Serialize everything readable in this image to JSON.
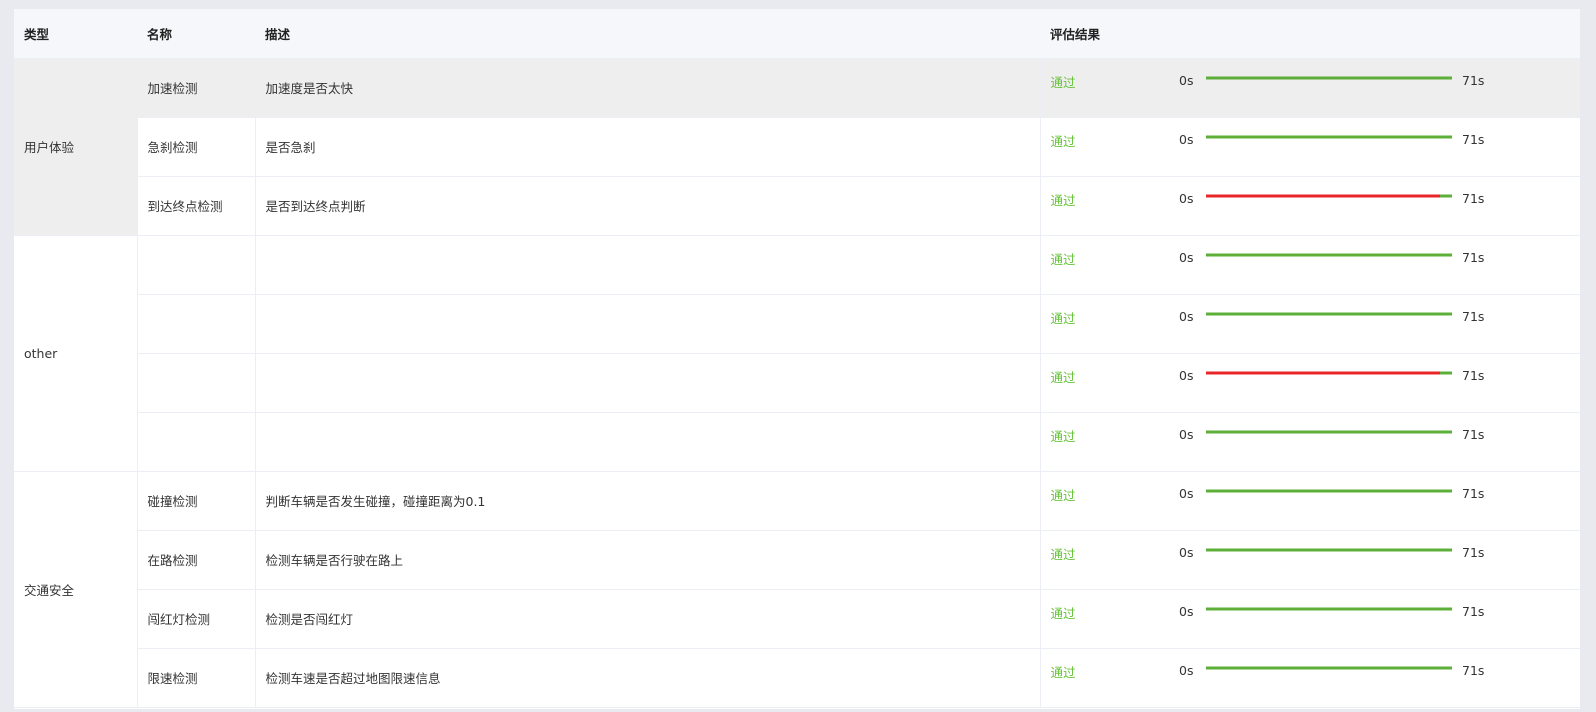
{
  "table": {
    "headers": {
      "type": "类型",
      "name": "名称",
      "desc": "描述",
      "result": "评估结果"
    },
    "groups": [
      {
        "label": "用户体验"
      },
      {
        "label": "other"
      },
      {
        "label": "交通安全"
      }
    ],
    "rows": [
      {
        "name": "加速检测",
        "desc": "加速度是否太快",
        "result": "通过",
        "start": "0s",
        "end": "71s",
        "fail_fraction": 0,
        "highlight": true
      },
      {
        "name": "急刹检测",
        "desc": "是否急刹",
        "result": "通过",
        "start": "0s",
        "end": "71s",
        "fail_fraction": 0
      },
      {
        "name": "到达终点检测",
        "desc": "是否到达终点判断",
        "result": "通过",
        "start": "0s",
        "end": "71s",
        "fail_fraction": 0.95
      },
      {
        "name": "",
        "desc": "",
        "result": "通过",
        "start": "0s",
        "end": "71s",
        "fail_fraction": 0
      },
      {
        "name": "",
        "desc": "",
        "result": "通过",
        "start": "0s",
        "end": "71s",
        "fail_fraction": 0
      },
      {
        "name": "",
        "desc": "",
        "result": "通过",
        "start": "0s",
        "end": "71s",
        "fail_fraction": 0.95
      },
      {
        "name": "",
        "desc": "",
        "result": "通过",
        "start": "0s",
        "end": "71s",
        "fail_fraction": 0
      },
      {
        "name": "碰撞检测",
        "desc": "判断车辆是否发生碰撞，碰撞距离为0.1",
        "result": "通过",
        "start": "0s",
        "end": "71s",
        "fail_fraction": 0
      },
      {
        "name": "在路检测",
        "desc": "检测车辆是否行驶在路上",
        "result": "通过",
        "start": "0s",
        "end": "71s",
        "fail_fraction": 0
      },
      {
        "name": "闯红灯检测",
        "desc": "检测是否闯红灯",
        "result": "通过",
        "start": "0s",
        "end": "71s",
        "fail_fraction": 0
      },
      {
        "name": "限速检测",
        "desc": "检测车速是否超过地图限速信息",
        "result": "通过",
        "start": "0s",
        "end": "71s",
        "fail_fraction": 0
      }
    ]
  },
  "colors": {
    "pass": "#67c23a",
    "timeline_ok": "#5eaf3a",
    "timeline_fail": "#e8262a"
  }
}
